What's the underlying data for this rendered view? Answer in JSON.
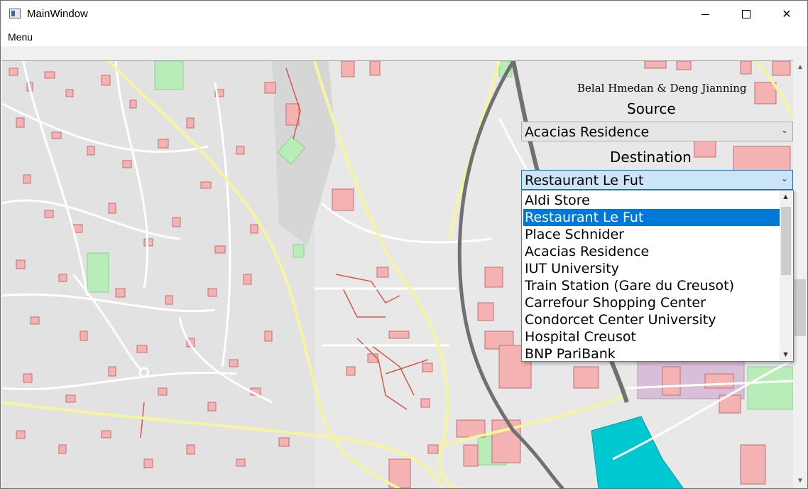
{
  "window": {
    "title": "MainWindow",
    "close_glyph": "✕",
    "buttons": [
      "minimize-icon",
      "maximize-icon",
      "close-icon"
    ]
  },
  "menubar": {
    "menu_label": "Menu"
  },
  "panel": {
    "authors": "Belal Hmedan & Deng Jianning",
    "source_label": "Source",
    "source_value": "Acacias Residence",
    "destination_label": "Destination",
    "destination_value": "Restaurant Le Fut",
    "dropdown_items": [
      "Aldi Store",
      "Restaurant Le Fut",
      "Place Schnider",
      "Acacias Residence",
      "IUT University",
      "Train Station (Gare du Creusot)",
      "Carrefour Shopping Center",
      "Condorcet Center University",
      "Hospital Creusot",
      "BNP PariBank"
    ],
    "selected_index": 1,
    "chevron": "⌄",
    "scroll_up": "▲",
    "scroll_down": "▼"
  },
  "colors": {
    "map_background": "#e6e6e6",
    "buildings": "#f5b2b2",
    "parks": "#b8ecb8",
    "water": "#00c8d0",
    "primary_road": "#f5f5a0",
    "railway": "#707070",
    "selection": "#0078d7"
  }
}
